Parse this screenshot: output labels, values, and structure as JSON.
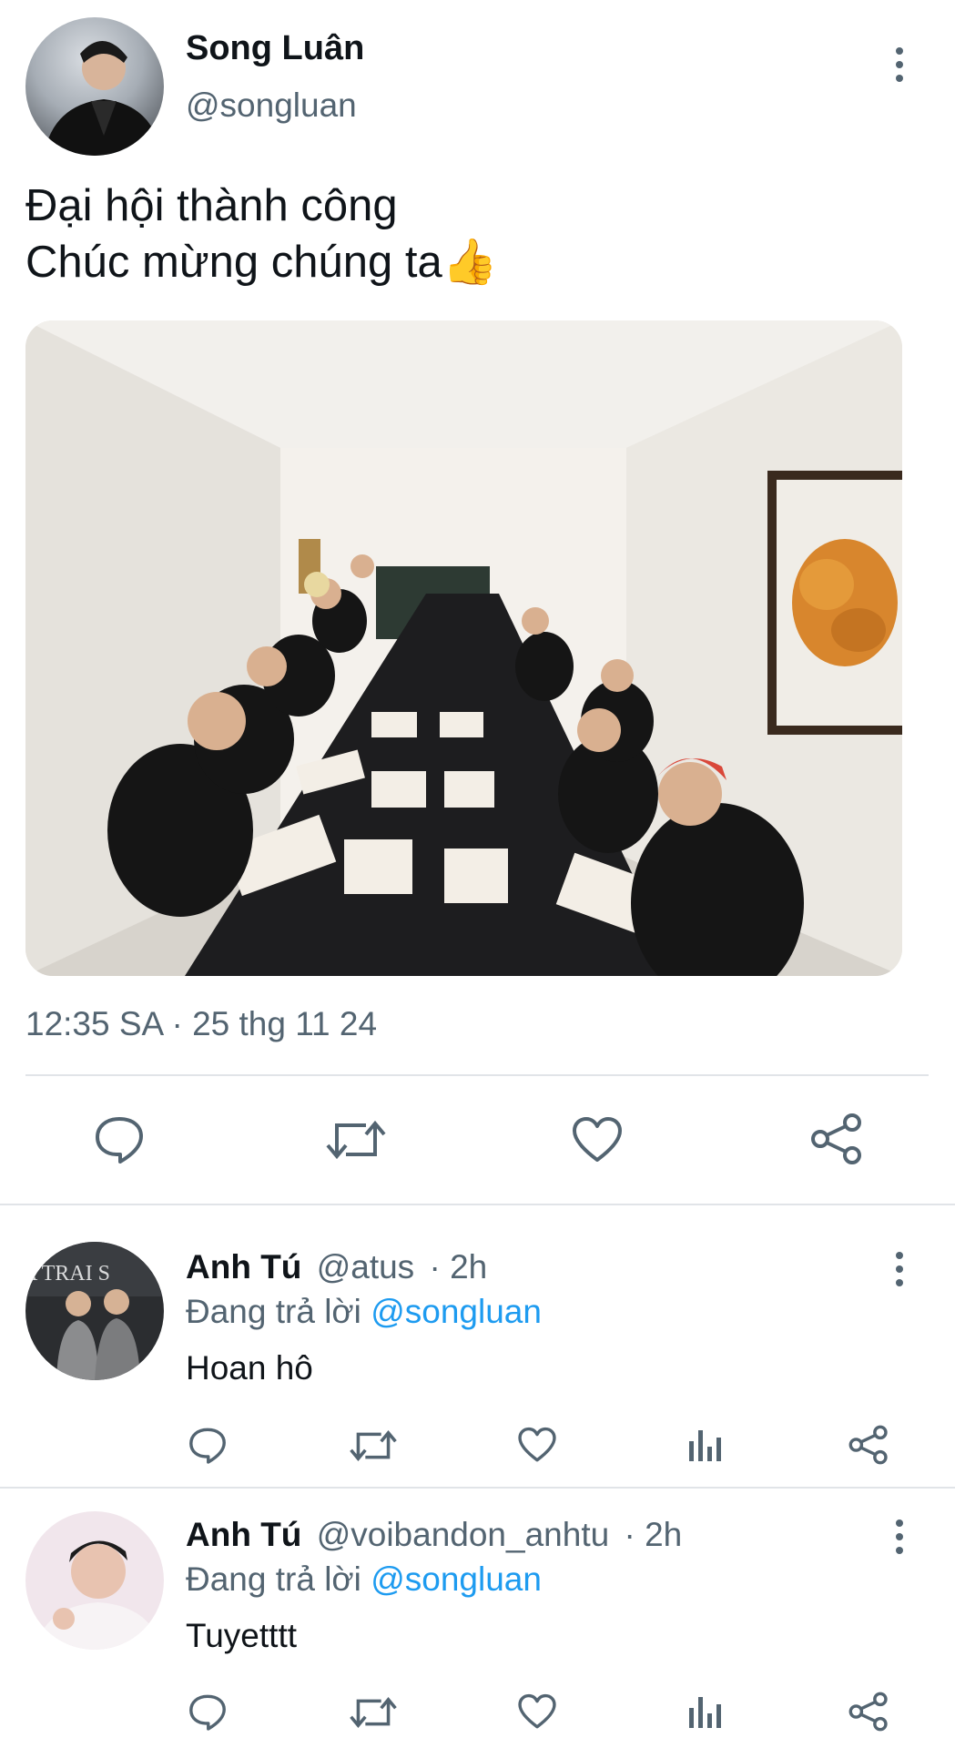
{
  "tweet": {
    "author_name": "Song Luân",
    "author_handle": "@songluan",
    "text_line1": "Đại hội thành công",
    "text_line2": "Chúc mừng chúng ta",
    "emoji": "👍",
    "timestamp": "12:35 SA · 25 thg 11 24"
  },
  "replies": [
    {
      "name": "Anh Tú",
      "handle": "@atus",
      "time": "· 2h",
      "replying_prefix": "Đang trả lời",
      "replying_to": "@songluan",
      "text": "Hoan hô",
      "avatar_banner": "A TRAI S"
    },
    {
      "name": "Anh Tú",
      "handle": "@voibandon_anhtu",
      "time": "· 2h",
      "replying_prefix": "Đang trả lời",
      "replying_to": "@songluan",
      "text": "Tuyetttt"
    }
  ],
  "icons": {
    "reply": "speech-bubble-icon",
    "retweet": "retweet-arrows-icon",
    "like": "heart-icon",
    "views": "bar-chart-icon",
    "share": "share-nodes-icon",
    "more": "more-vertical-icon"
  },
  "colors": {
    "text": "#0f1419",
    "muted": "#536471",
    "link": "#1d9bf0",
    "divider": "#e1e4e8"
  }
}
